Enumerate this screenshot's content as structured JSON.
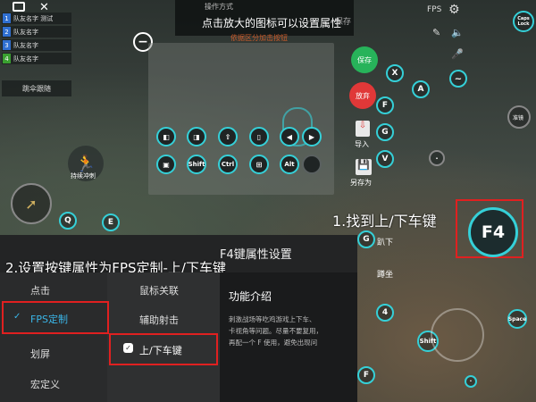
{
  "team": {
    "members": [
      {
        "num": "1",
        "name": "队友名字 测试",
        "color": "#2f6fd0"
      },
      {
        "num": "2",
        "name": "队友名字",
        "color": "#2f6fd0"
      },
      {
        "num": "3",
        "name": "队友名字",
        "color": "#2f6fd0"
      },
      {
        "num": "4",
        "name": "队友名字",
        "color": "#3aa030"
      }
    ],
    "follow_label": "跳伞跟随"
  },
  "hint_top": {
    "small": "操作方式",
    "main": "点击放大的图标可以设置属性",
    "save_bg": "保存",
    "red": "依据区分加击按钮"
  },
  "actions": {
    "save": "保存",
    "discard": "放弃",
    "import": "导入",
    "save_as": "另存为"
  },
  "keys": {
    "shift": "Shift",
    "ctrl": "Ctrl",
    "alt": "Alt",
    "q": "Q",
    "e": "E",
    "x": "X",
    "a": "A",
    "f": "F",
    "g": "G",
    "v": "V",
    "four": "4",
    "space": "Space",
    "shift2": "Shift",
    "f2": "F",
    "f4": "F4",
    "caps": "Caps Lock",
    "sprint": "持续冲刺",
    "aim": "准镜"
  },
  "annotations": {
    "step1": "1.找到上/下车键",
    "step2": "2.设置按键属性为FPS定制-上/下车键"
  },
  "dialog": {
    "title": "F4键属性设置",
    "col1": [
      "点击",
      "FPS定制",
      "划屏",
      "宏定义"
    ],
    "col2": [
      "鼠标关联",
      "辅助射击",
      "上/下车键"
    ],
    "desc_title": "功能介绍",
    "desc_text": "刺激战场等吃鸡游戏上下车、\n卡视角等问题。尽量不要复用，\n再配一个 F 使用，避免出现问"
  },
  "behind": {
    "lie": "趴下",
    "squat": "蹲坐"
  },
  "colors": {
    "accent": "#35d0d8",
    "save_green": "#27b35a",
    "discard_red": "#e03838",
    "highlight_red": "#e02020",
    "selected_blue": "#3ab6e8"
  }
}
